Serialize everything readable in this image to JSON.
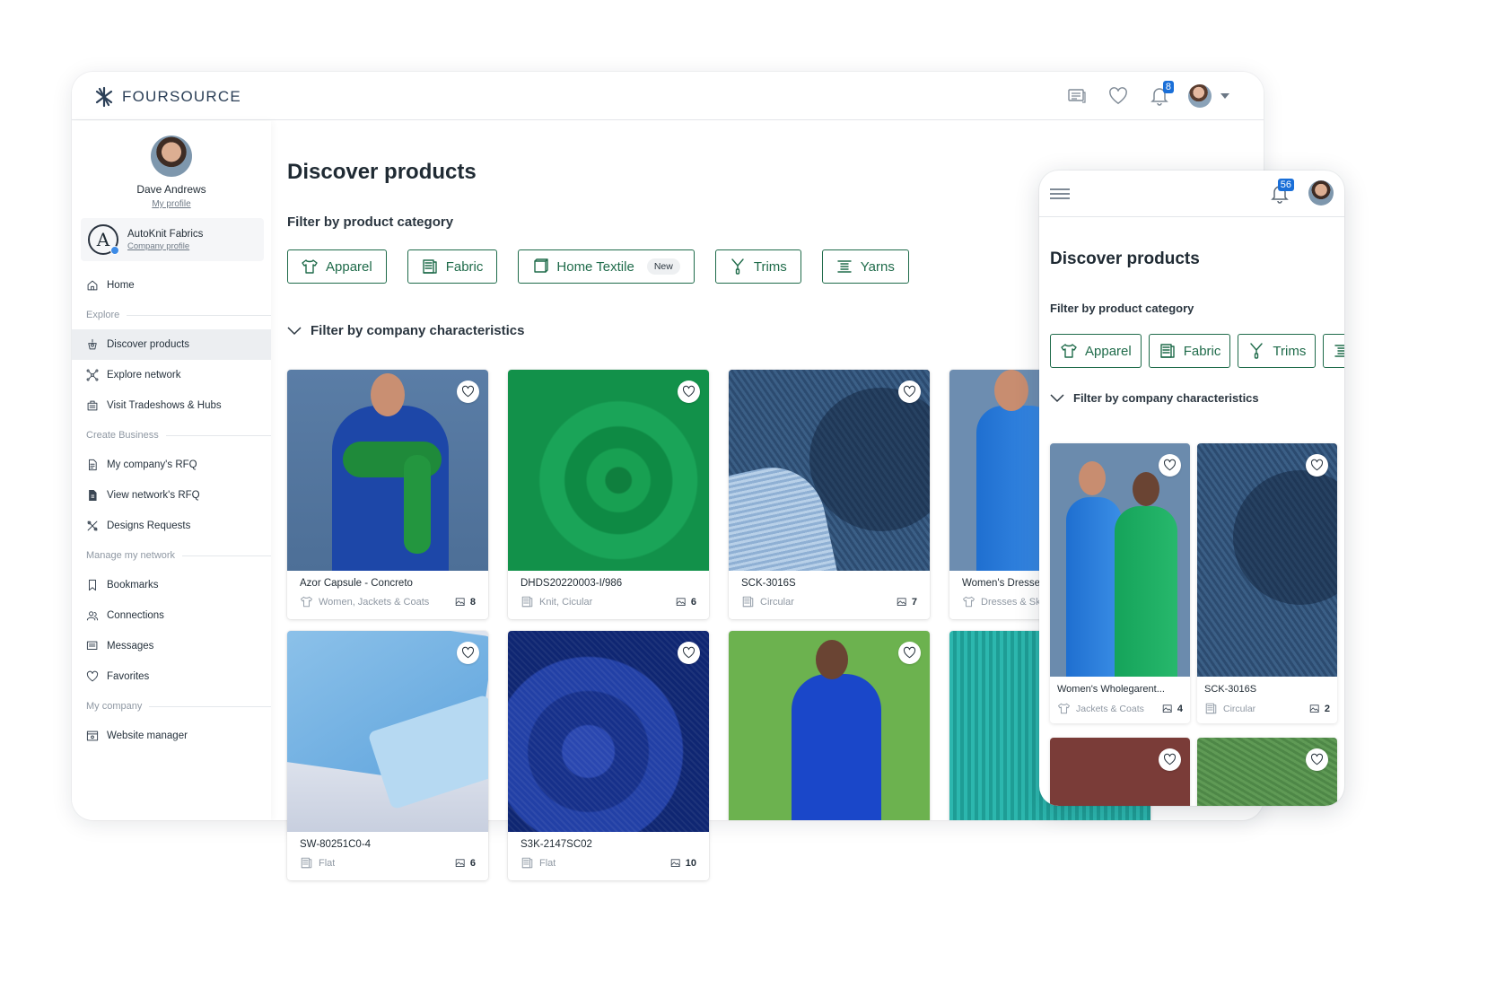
{
  "brand": {
    "name": "FOURSOURCE",
    "color": "#2b3f57",
    "accent": "#1f6b4a",
    "badge_color": "#1a6fd8"
  },
  "desktop": {
    "topbar": {
      "notifications_count": "8"
    },
    "sidebar": {
      "user_name": "Dave Andrews",
      "profile_link": "My profile",
      "company_name": "AutoKnit Fabrics",
      "company_link": "Company profile",
      "nav": [
        {
          "type": "item",
          "label": "Home",
          "icon": "home-icon"
        },
        {
          "type": "section",
          "label": "Explore"
        },
        {
          "type": "item",
          "label": "Discover products",
          "icon": "discover-icon",
          "active": true
        },
        {
          "type": "item",
          "label": "Explore network",
          "icon": "network-icon"
        },
        {
          "type": "item",
          "label": "Visit Tradeshows & Hubs",
          "icon": "tradeshow-icon"
        },
        {
          "type": "section",
          "label": "Create Business"
        },
        {
          "type": "item",
          "label": "My company's RFQ",
          "icon": "document-icon"
        },
        {
          "type": "item",
          "label": "View network's RFQ",
          "icon": "rfq-icon"
        },
        {
          "type": "item",
          "label": "Designs Requests",
          "icon": "design-icon"
        },
        {
          "type": "section",
          "label": "Manage my network"
        },
        {
          "type": "item",
          "label": "Bookmarks",
          "icon": "bookmark-icon"
        },
        {
          "type": "item",
          "label": "Connections",
          "icon": "connections-icon"
        },
        {
          "type": "item",
          "label": "Messages",
          "icon": "messages-icon"
        },
        {
          "type": "item",
          "label": "Favorites",
          "icon": "heart-icon"
        },
        {
          "type": "section",
          "label": "My company"
        },
        {
          "type": "item",
          "label": "Website manager",
          "icon": "website-icon"
        }
      ]
    },
    "main": {
      "title": "Discover products",
      "filter_category_label": "Filter by product category",
      "categories": [
        {
          "label": "Apparel",
          "icon": "shirt-icon"
        },
        {
          "label": "Fabric",
          "icon": "fabric-icon"
        },
        {
          "label": "Home Textile",
          "icon": "home-textile-icon",
          "tag": "New"
        },
        {
          "label": "Trims",
          "icon": "zipper-icon"
        },
        {
          "label": "Yarns",
          "icon": "yarn-icon"
        }
      ],
      "filter_company_label": "Filter by company characteristics",
      "products": [
        {
          "title": "Azor Capsule - Concreto",
          "subtitle": "Women, Jackets & Coats",
          "count": "8",
          "icon": "shirt-icon"
        },
        {
          "title": "DHDS20220003-I/986",
          "subtitle": "Knit, Cicular",
          "count": "6",
          "icon": "fabric-icon"
        },
        {
          "title": "SCK-3016S",
          "subtitle": "Circular",
          "count": "7",
          "icon": "fabric-icon"
        },
        {
          "title": "Women's Dresses",
          "subtitle": "Dresses & Sk",
          "count": "",
          "icon": "shirt-icon"
        },
        {
          "title": "SW-80251C0-4",
          "subtitle": "Flat",
          "count": "6",
          "icon": "fabric-icon"
        },
        {
          "title": "S3K-2147SC02",
          "subtitle": "Flat",
          "count": "10",
          "icon": "fabric-icon"
        }
      ]
    }
  },
  "mobile": {
    "notifications_count": "56",
    "title": "Discover products",
    "filter_category_label": "Filter by product category",
    "categories": [
      {
        "label": "Apparel",
        "icon": "shirt-icon"
      },
      {
        "label": "Fabric",
        "icon": "fabric-icon"
      },
      {
        "label": "Trims",
        "icon": "zipper-icon"
      }
    ],
    "filter_company_label": "Filter by company characteristics",
    "products": [
      {
        "title": "Women's Wholegarent...",
        "subtitle": "Jackets & Coats",
        "count": "4",
        "icon": "shirt-icon"
      },
      {
        "title": "SCK-3016S",
        "subtitle": "Circular",
        "count": "2",
        "icon": "fabric-icon"
      }
    ]
  }
}
